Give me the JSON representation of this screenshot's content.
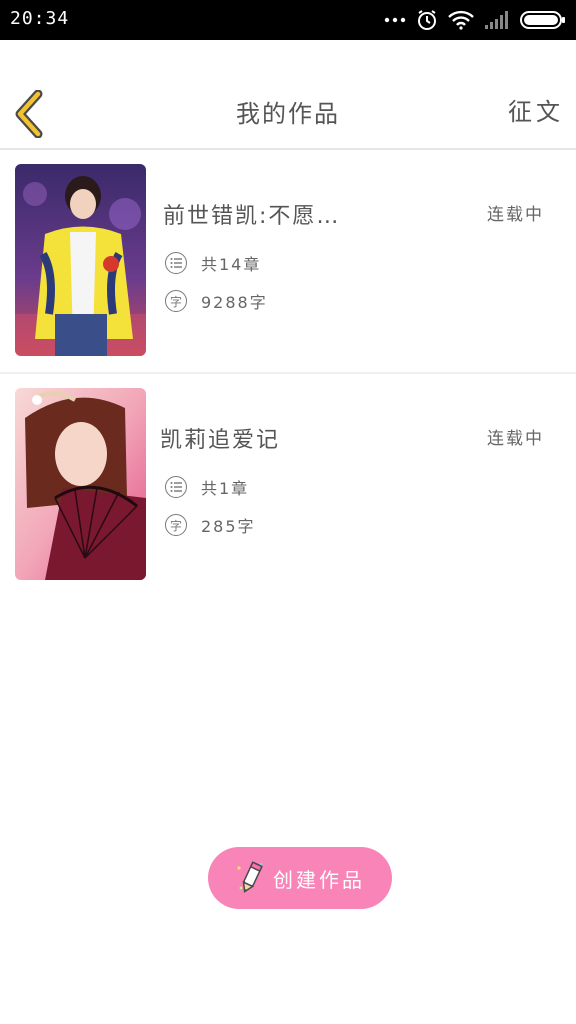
{
  "status_bar": {
    "time": "20:34",
    "icons": [
      "more-dots-icon",
      "alarm-icon",
      "wifi-icon",
      "signal-icon",
      "battery-icon"
    ]
  },
  "header": {
    "title": "我的作品",
    "back_icon": "chevron-left-icon",
    "right_action": "征文"
  },
  "works": [
    {
      "title": "前世错凯:不愿…",
      "status": "连载中",
      "chapters": "共14章",
      "words": "9288字",
      "cover": "cover-image-yellow-jacket"
    },
    {
      "title": "凯莉追爱记",
      "status": "连载中",
      "chapters": "共1章",
      "words": "285字",
      "cover": "cover-image-fan"
    }
  ],
  "meta_icons": {
    "chapters": "list-icon",
    "words": "字"
  },
  "create_button": {
    "label": "创建作品",
    "icon": "pencil-icon",
    "color": "#f884b8"
  },
  "colors": {
    "accent_yellow": "#f2c230",
    "button_pink": "#f884b8",
    "divider": "#e6e6e6"
  }
}
